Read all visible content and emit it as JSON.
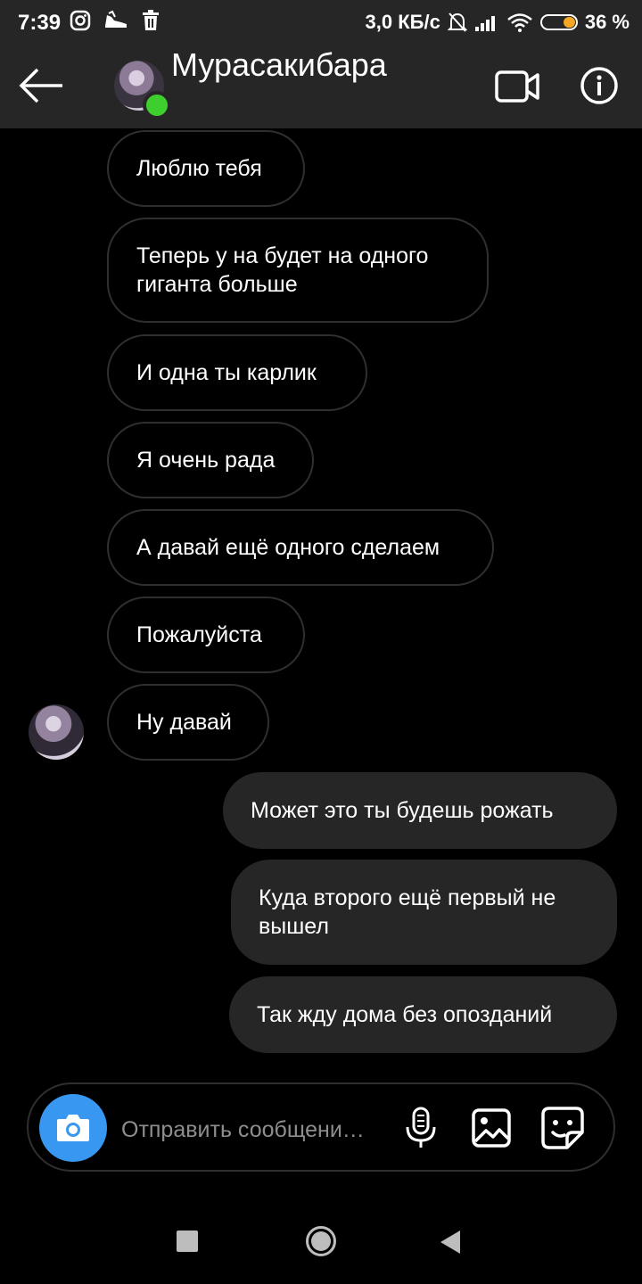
{
  "status_bar": {
    "time": "7:39",
    "network_speed": "3,0 КБ/с",
    "battery_percent": "36 %",
    "battery_level": 0.36,
    "icons": [
      "instagram-icon",
      "sneaker-icon",
      "trash-icon",
      "bell-off-icon",
      "signal-icon",
      "wifi-icon",
      "battery-icon"
    ]
  },
  "header": {
    "contact_name": "Мурасакибара",
    "online": true,
    "online_color": "#3ecf2f"
  },
  "messages": [
    {
      "dir": "in",
      "text": "Люблю тебя"
    },
    {
      "dir": "in",
      "text": "Теперь у на будет на одного гиганта больше"
    },
    {
      "dir": "in",
      "text": "И одна ты карлик"
    },
    {
      "dir": "in",
      "text": "Я очень рада"
    },
    {
      "dir": "in",
      "text": "А давай ещё одного сделаем"
    },
    {
      "dir": "in",
      "text": "Пожалуйста"
    },
    {
      "dir": "in",
      "text": "Ну давай"
    },
    {
      "dir": "out",
      "text": "Может это ты будешь рожать"
    },
    {
      "dir": "out",
      "text": "Куда второго ещё первый не вышел"
    },
    {
      "dir": "out",
      "text": "Так жду дома без опозданий"
    }
  ],
  "composer": {
    "placeholder": "Отправить сообщени…",
    "value": "",
    "accent": "#3897f0"
  }
}
